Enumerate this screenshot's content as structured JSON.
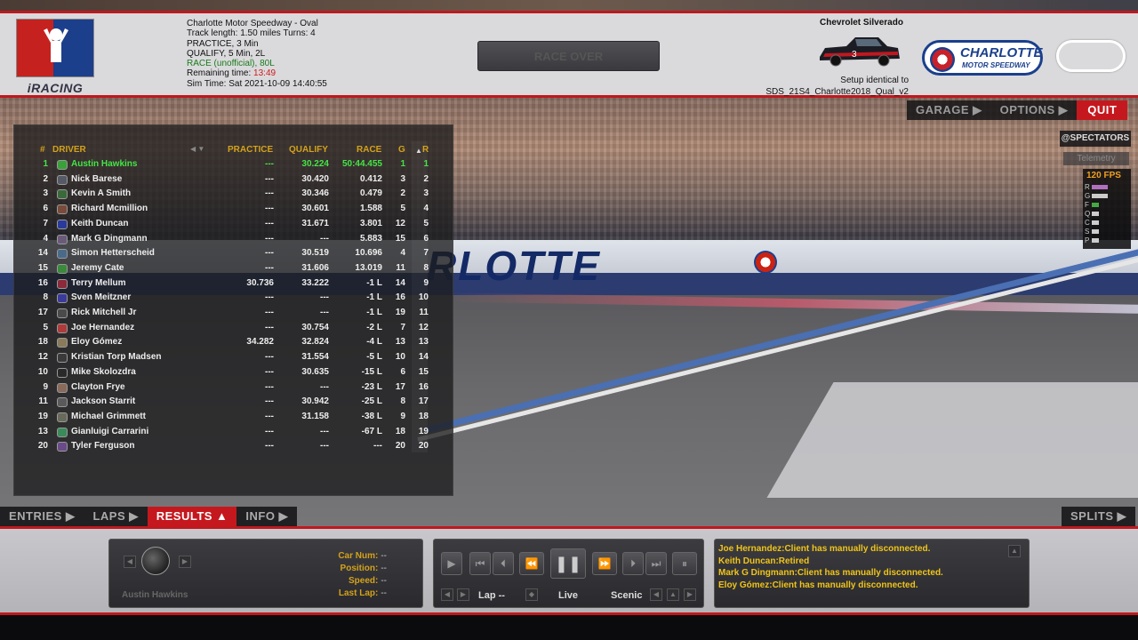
{
  "header": {
    "brand": "iRACING",
    "track_name": "Charlotte Motor Speedway - Oval",
    "track_info": "Track length: 1.50 miles Turns: 4",
    "practice": "PRACTICE, 3 Min",
    "qualify": "QUALIFY, 5 Min, 2L",
    "race": "RACE (unofficial), 80L",
    "remaining_label": "Remaining time:",
    "remaining_value": "13:49",
    "sim_time": "Sim Time: Sat 2021-10-09 14:40:55",
    "race_over": "RACE OVER",
    "car_name": "Chevrolet Silverado",
    "setup_line1": "Setup identical to",
    "setup_line2": "SDS_21S4_Charlotte2018_Qual_v2",
    "track_logo_line1": "CHARLOTTE",
    "track_logo_line2": "MOTOR SPEEDWAY"
  },
  "menu_right": {
    "garage": "GARAGE ▶",
    "options": "OPTIONS ▶",
    "quit": "QUIT"
  },
  "overlay": {
    "spectators": "@SPECTATORS",
    "telemetry": "Telemetry",
    "fps": "120 FPS",
    "meters": [
      "R",
      "G",
      "F",
      "Q",
      "C",
      "S",
      "P"
    ]
  },
  "results": {
    "headers": {
      "pos": "#",
      "driver": "DRIVER",
      "practice": "PRACTICE",
      "qualify": "QUALIFY",
      "race": "RACE",
      "g": "G",
      "r": "R"
    },
    "rows": [
      {
        "pos": "1",
        "driver": "Austin Hawkins",
        "practice": "---",
        "qualify": "30.224",
        "race": "50:44.455",
        "g": "1",
        "r": "1",
        "color": "#3aa13a"
      },
      {
        "pos": "2",
        "driver": "Nick Barese",
        "practice": "---",
        "qualify": "30.420",
        "race": "0.412",
        "g": "3",
        "r": "2",
        "color": "#555a66"
      },
      {
        "pos": "3",
        "driver": "Kevin A Smith",
        "practice": "---",
        "qualify": "30.346",
        "race": "0.479",
        "g": "2",
        "r": "3",
        "color": "#3a6a3a"
      },
      {
        "pos": "6",
        "driver": "Richard Mcmillion",
        "practice": "---",
        "qualify": "30.601",
        "race": "1.588",
        "g": "5",
        "r": "4",
        "color": "#7a4a3a"
      },
      {
        "pos": "7",
        "driver": "Keith Duncan",
        "practice": "---",
        "qualify": "31.671",
        "race": "3.801",
        "g": "12",
        "r": "5",
        "color": "#2a3a9a"
      },
      {
        "pos": "4",
        "driver": "Mark G Dingmann",
        "practice": "---",
        "qualify": "---",
        "race": "5.883",
        "g": "15",
        "r": "6",
        "color": "#6a5a7a"
      },
      {
        "pos": "14",
        "driver": "Simon Hetterscheid",
        "practice": "---",
        "qualify": "30.519",
        "race": "10.696",
        "g": "4",
        "r": "7",
        "color": "#4a6a8a"
      },
      {
        "pos": "15",
        "driver": "Jeremy Cate",
        "practice": "---",
        "qualify": "31.606",
        "race": "13.019",
        "g": "11",
        "r": "8",
        "color": "#3a8a3a"
      },
      {
        "pos": "16",
        "driver": "Terry Mellum",
        "practice": "30.736",
        "qualify": "33.222",
        "race": "-1 L",
        "g": "14",
        "r": "9",
        "color": "#8a2a3a"
      },
      {
        "pos": "8",
        "driver": "Sven Meitzner",
        "practice": "---",
        "qualify": "---",
        "race": "-1 L",
        "g": "16",
        "r": "10",
        "color": "#3a3a9a"
      },
      {
        "pos": "17",
        "driver": "Rick Mitchell Jr",
        "practice": "---",
        "qualify": "---",
        "race": "-1 L",
        "g": "19",
        "r": "11",
        "color": "#4a4a4a"
      },
      {
        "pos": "5",
        "driver": "Joe Hernandez",
        "practice": "---",
        "qualify": "30.754",
        "race": "-2 L",
        "g": "7",
        "r": "12",
        "color": "#b03a3a"
      },
      {
        "pos": "18",
        "driver": "Eloy Gómez",
        "practice": "34.282",
        "qualify": "32.824",
        "race": "-4 L",
        "g": "13",
        "r": "13",
        "color": "#8a7a5a"
      },
      {
        "pos": "12",
        "driver": "Kristian Torp Madsen",
        "practice": "---",
        "qualify": "31.554",
        "race": "-5 L",
        "g": "10",
        "r": "14",
        "color": "#3a3a3a"
      },
      {
        "pos": "10",
        "driver": "Mike Skolozdra",
        "practice": "---",
        "qualify": "30.635",
        "race": "-15 L",
        "g": "6",
        "r": "15",
        "color": "#2a2a2a"
      },
      {
        "pos": "9",
        "driver": "Clayton Frye",
        "practice": "---",
        "qualify": "---",
        "race": "-23 L",
        "g": "17",
        "r": "16",
        "color": "#8a6a5a"
      },
      {
        "pos": "11",
        "driver": "Jackson Starrit",
        "practice": "---",
        "qualify": "30.942",
        "race": "-25 L",
        "g": "8",
        "r": "17",
        "color": "#5a5a5a"
      },
      {
        "pos": "19",
        "driver": "Michael Grimmett",
        "practice": "---",
        "qualify": "31.158",
        "race": "-38 L",
        "g": "9",
        "r": "18",
        "color": "#6a6a5a"
      },
      {
        "pos": "13",
        "driver": "Gianluigi Carrarini",
        "practice": "---",
        "qualify": "---",
        "race": "-67 L",
        "g": "18",
        "r": "19",
        "color": "#3a8a5a"
      },
      {
        "pos": "20",
        "driver": "Tyler Ferguson",
        "practice": "---",
        "qualify": "---",
        "race": "---",
        "g": "20",
        "r": "20",
        "color": "#6a4a8a"
      }
    ]
  },
  "tabs": {
    "entries": "ENTRIES ▶",
    "laps": "LAPS ▶",
    "results": "RESULTS ▲",
    "info": "INFO ▶",
    "splits": "SPLITS ▶"
  },
  "car_panel": {
    "driver": "Austin Hawkins",
    "car_num_label": "Car Num:",
    "car_num_value": "--",
    "position_label": "Position:",
    "position_value": "--",
    "speed_label": "Speed:",
    "speed_value": "--",
    "last_lap_label": "Last Lap:",
    "last_lap_value": "--"
  },
  "replay": {
    "lap": "Lap --",
    "live": "Live",
    "camera": "Scenic"
  },
  "messages": [
    "Joe Hernandez:Client has manually disconnected.",
    "Keith Duncan:Retired",
    "Mark G Dingmann:Client has manually disconnected.",
    "Eloy Gómez:Client has manually disconnected."
  ],
  "colors": {
    "accent": "#c5181e",
    "gold": "#d4a21a",
    "leader": "#46e546",
    "message": "#f0c419"
  }
}
